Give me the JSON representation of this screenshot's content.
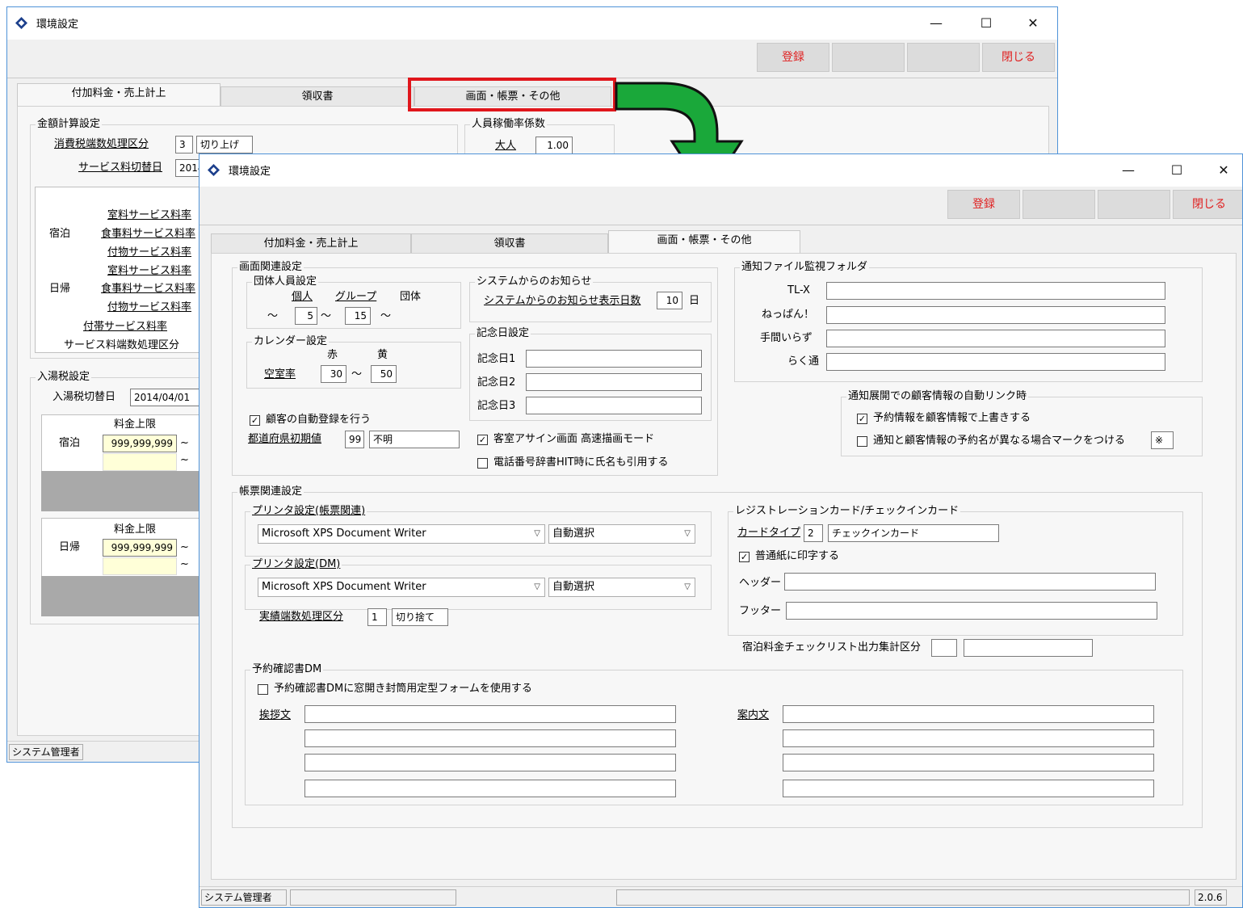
{
  "back_window": {
    "title": "環境設定",
    "toolbar": {
      "register": "登録",
      "close": "閉じる"
    },
    "tabs": [
      "付加料金・売上計上",
      "領収書",
      "画面・帳票・その他"
    ],
    "kingaku": {
      "title": "金額計算設定",
      "tax_label": "消費税端数処理区分",
      "tax_code": "3",
      "tax_text": "切り上げ",
      "service_label": "サービス料切替日",
      "service_date": "2014"
    },
    "rates": {
      "stay": "宿泊",
      "day": "日帰",
      "room": "室料サービス料率",
      "food": "食事料サービス料率",
      "goods": "付物サービス料率",
      "extra": "付帯サービス料率",
      "rounding": "サービス料端数処理区分"
    },
    "jinin": {
      "title": "人員稼働率係数",
      "adult_label": "大人",
      "adult_value": "1.00"
    },
    "nyuto": {
      "title": "入湯税設定",
      "switch_label": "入湯税切替日",
      "switch_date": "2014/04/01",
      "limit_label": "料金上限",
      "stay": "宿泊",
      "day": "日帰",
      "value": "999,999,999",
      "tilde": "~"
    },
    "status_user": "システム管理者"
  },
  "front_window": {
    "title": "環境設定",
    "toolbar": {
      "register": "登録",
      "close": "閉じる"
    },
    "tabs": [
      "付加料金・売上計上",
      "領収書",
      "画面・帳票・その他"
    ],
    "screen": {
      "title": "画面関連設定",
      "dantai": {
        "title": "団体人員設定",
        "kojin": "個人",
        "group": "グループ",
        "dantai": "団体",
        "t1": "～",
        "v1": "5",
        "t2": "～",
        "v2": "15",
        "t3": "～"
      },
      "calendar": {
        "title": "カレンダー設定",
        "red": "赤",
        "yellow": "黄",
        "empty": "空室率",
        "v1": "30",
        "tilde": "～",
        "v2": "50"
      },
      "auto_register": "顧客の自動登録を行う",
      "pref_label": "都道府県初期値",
      "pref_code": "99",
      "pref_text": "不明",
      "notice": {
        "title": "システムからのお知らせ",
        "label": "システムからのお知らせ表示日数",
        "days": "10",
        "unit": "日"
      },
      "kinenbi": {
        "title": "記念日設定",
        "l1": "記念日1",
        "l2": "記念日2",
        "l3": "記念日3"
      },
      "assign": "客室アサイン画面 高速描画モード",
      "phone": "電話番号辞書HIT時に氏名も引用する"
    },
    "notify": {
      "title": "通知ファイル監視フォルダ",
      "items": [
        "TL-X",
        "ねっぱん！",
        "手間いらず",
        "らく通"
      ]
    },
    "autolink": {
      "title": "通知展開での顧客情報の自動リンク時",
      "overwrite": "予約情報を顧客情報で上書きする",
      "mark": "通知と顧客情報の予約名が異なる場合マークをつける",
      "mark_symbol": "※"
    },
    "report": {
      "title": "帳票関連設定",
      "printer1": {
        "title": "プリンタ設定(帳票関連)",
        "printer": "Microsoft XPS Document Writer",
        "tray": "自動選択"
      },
      "printer2": {
        "title": "プリンタ設定(DM)",
        "printer": "Microsoft XPS Document Writer",
        "tray": "自動選択"
      },
      "rounding_label": "実績端数処理区分",
      "rounding_code": "1",
      "rounding_text": "切り捨て",
      "regcard": {
        "title": "レジストレーションカード/チェックインカード",
        "type_label": "カードタイプ",
        "type_code": "2",
        "type_text": "チェックインカード",
        "plain": "普通紙に印字する",
        "header": "ヘッダー",
        "footer": "フッター"
      },
      "checklist_label": "宿泊料金チェックリスト出力集計区分"
    },
    "dm": {
      "title": "予約確認書DM",
      "window_env": "予約確認書DMに窓開き封筒用定型フォームを使用する",
      "greeting": "挨拶文",
      "guide": "案内文"
    },
    "status": {
      "user": "システム管理者",
      "version": "2.0.6"
    }
  },
  "colors": {
    "accent_red": "#e02020",
    "arrow_green": "#1aa83a",
    "highlight": "#e0161c"
  }
}
